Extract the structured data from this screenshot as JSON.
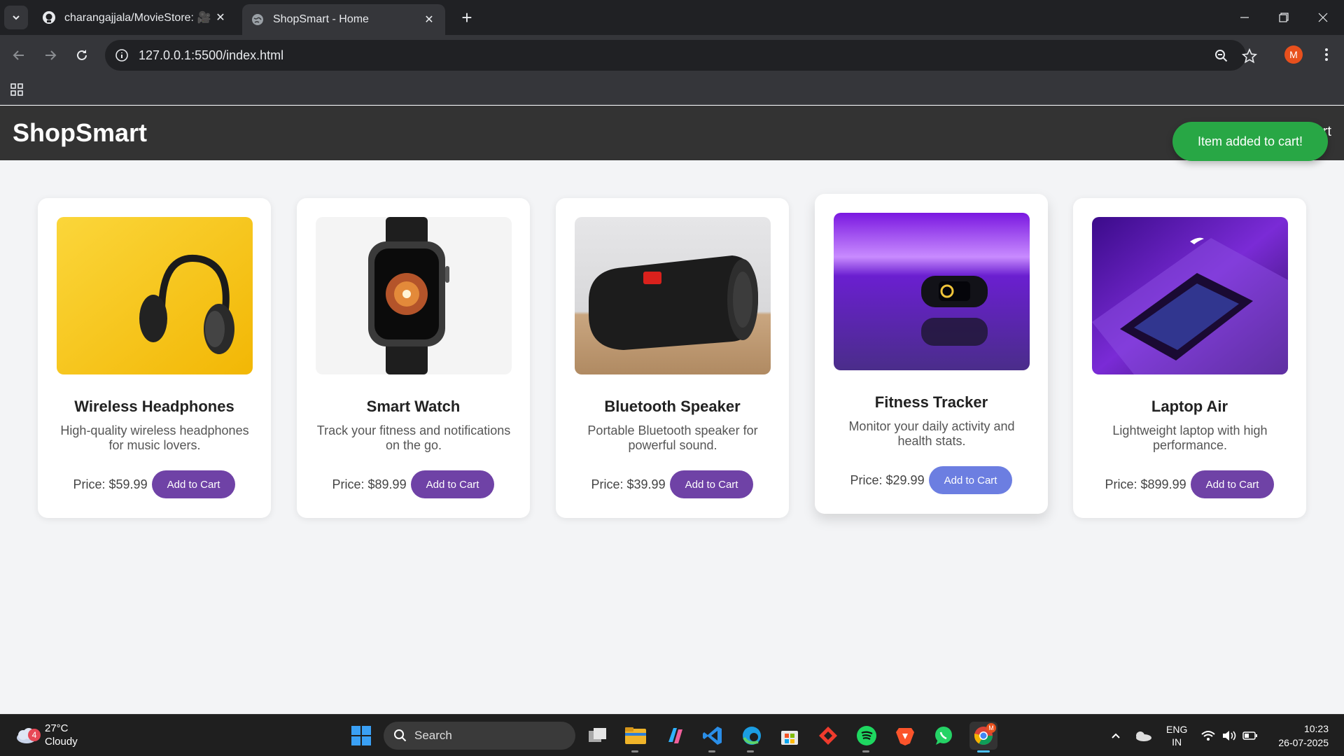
{
  "browser": {
    "tabs": [
      {
        "title": "charangajjala/MovieStore: 🎥 🍿",
        "active": false,
        "close": "✕"
      },
      {
        "title": "ShopSmart - Home",
        "active": true,
        "close": "✕"
      }
    ],
    "new_tab": "+",
    "url": "127.0.0.1:5500/index.html",
    "profile_initial": "M"
  },
  "page": {
    "brand": "ShopSmart",
    "header_link": "Cart",
    "toast": "Item added to cart!",
    "colors": {
      "header": "#333333",
      "button": "#6f42a6",
      "button_hover": "#6c7ee1",
      "toast": "#28a745"
    },
    "products": [
      {
        "name": "Wireless Headphones",
        "description": "High-quality wireless headphones for music lovers.",
        "price": "Price: $59.99",
        "button": "Add to Cart",
        "image": "headphones-image"
      },
      {
        "name": "Smart Watch",
        "description": "Track your fitness and notifications on the go.",
        "price": "Price: $89.99",
        "button": "Add to Cart",
        "image": "smart-watch-image"
      },
      {
        "name": "Bluetooth Speaker",
        "description": "Portable Bluetooth speaker for powerful sound.",
        "price": "Price: $39.99",
        "button": "Add to Cart",
        "image": "speaker-image"
      },
      {
        "name": "Fitness Tracker",
        "description": "Monitor your daily activity and health stats.",
        "price": "Price: $29.99",
        "button": "Add to Cart",
        "image": "fitness-tracker-image"
      },
      {
        "name": "Laptop Air",
        "description": "Lightweight laptop with high performance.",
        "price": "Price: $899.99",
        "button": "Add to Cart",
        "image": "laptop-image"
      }
    ]
  },
  "taskbar": {
    "weather": {
      "temp": "27°C",
      "condition": "Cloudy",
      "badge": "4"
    },
    "search_placeholder": "Search",
    "lang": {
      "line1": "ENG",
      "line2": "IN"
    },
    "time": "10:23",
    "date": "26-07-2025",
    "profile_badge": "M"
  }
}
